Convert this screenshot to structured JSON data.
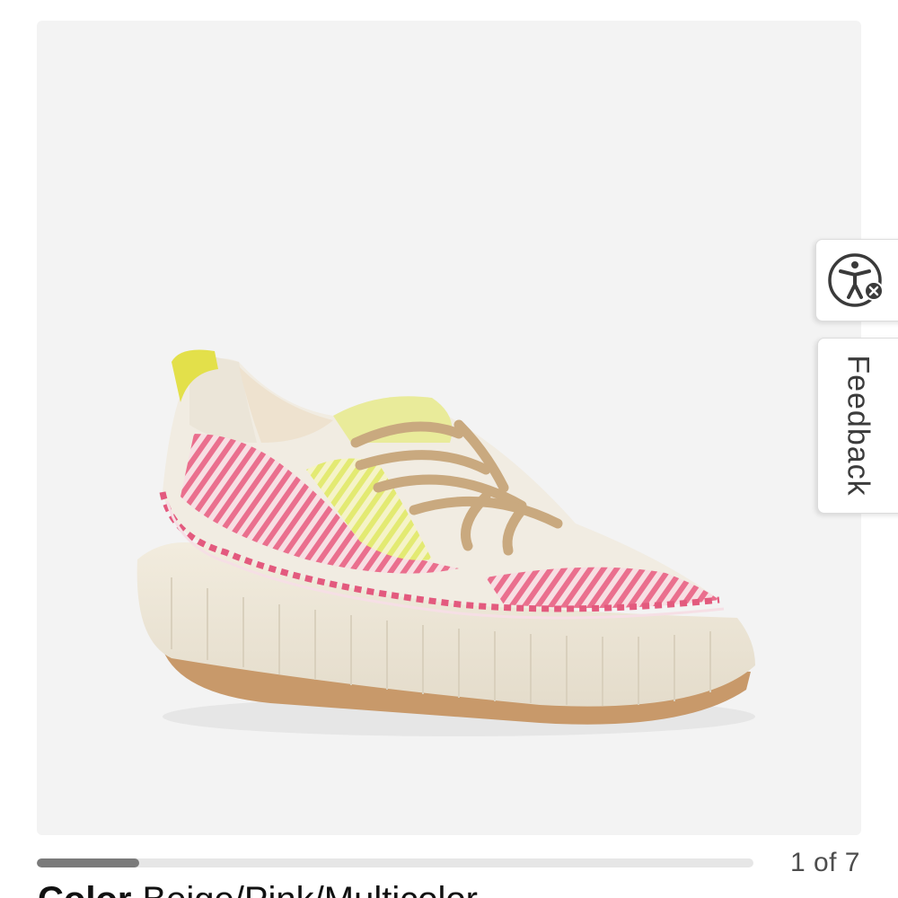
{
  "product": {
    "image_alt": "Beige/Pink/Multicolor platform sneaker",
    "color_label": "Color",
    "color_value": "Beige/Pink/Multicolor"
  },
  "gallery": {
    "counter": "1 of 7",
    "current_image": 1,
    "total_images": 7,
    "progress_fraction": 0.143
  },
  "side_tabs": {
    "accessibility_icon": "accessibility-person-icon",
    "feedback_label": "Feedback"
  },
  "colors": {
    "gallery_bg": "#f3f3f3",
    "progress_fill": "#7a7a7a",
    "progress_track": "#e6e6e6"
  }
}
